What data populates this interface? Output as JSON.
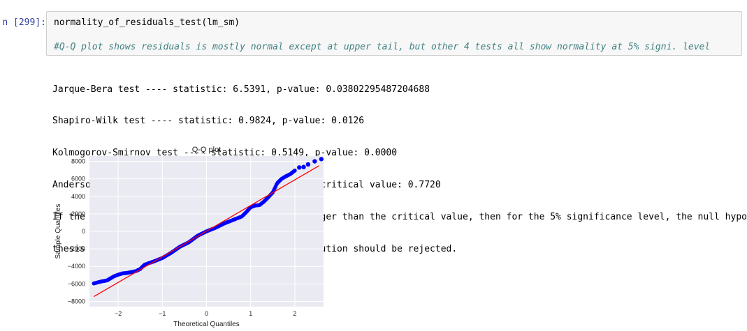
{
  "cell": {
    "prompt": "n [299]:",
    "code": "normality_of_residuals_test(lm_sm)",
    "comment": "#Q-Q plot shows residuals is mostly normal except at upper tail, but other 4 tests all show normality at 5% signi. level"
  },
  "output": {
    "lines": [
      "Jarque-Bera test ---- statistic: 6.5391, p-value: 0.03802295487204688",
      "Shapiro-Wilk test ---- statistic: 0.9824, p-value: 0.0126",
      "Kolmogorov-Smirnov test ---- statistic: 0.5149, p-value: 0.0000",
      "Anderson-Darling test ---- statistic: 0.6878, 5% critical value: 0.7720",
      "If the returned Anderson Draling statistic is larger than the critical value, then for the 5% significance level, the null hypo",
      "thesis that the data come from the Normal distribution should be rejected."
    ]
  },
  "chart_data": {
    "type": "scatter",
    "title": "Q-Q plot",
    "xlabel": "Theoretical Quantiles",
    "ylabel": "Sample Quantiles",
    "xlim": [
      -2.65,
      2.65
    ],
    "ylim": [
      -8600,
      8600
    ],
    "xticks": [
      -2,
      -1,
      0,
      1,
      2
    ],
    "xtick_labels": [
      "−2",
      "−1",
      "0",
      "1",
      "2"
    ],
    "yticks": [
      8000,
      6000,
      4000,
      2000,
      0,
      -2000,
      -4000,
      -6000,
      -8000
    ],
    "ytick_labels": [
      "8000",
      "6000",
      "4000",
      "2000",
      "0",
      "−2000",
      "−4000",
      "−6000",
      "−8000"
    ],
    "grid": true,
    "background": "#eaeaf2",
    "point_color": "#0000ff",
    "line_color": "#ff0000",
    "reference_line": {
      "x": [
        -2.55,
        2.55
      ],
      "y": [
        -7450,
        7500
      ]
    },
    "anchors": {
      "x": [
        -2.55,
        -2.4,
        -2.25,
        -2.1,
        -2.0,
        -1.9,
        -1.8,
        -1.6,
        -1.5,
        -1.4,
        -1.2,
        -1.0,
        -0.8,
        -0.6,
        -0.4,
        -0.2,
        0.0,
        0.2,
        0.4,
        0.6,
        0.8,
        0.9,
        1.0,
        1.1,
        1.2,
        1.3,
        1.4,
        1.5,
        1.6,
        1.7,
        1.8,
        1.9,
        2.0
      ],
      "y": [
        -5950,
        -5750,
        -5600,
        -5150,
        -4950,
        -4800,
        -4750,
        -4550,
        -4300,
        -3800,
        -3450,
        -3050,
        -2450,
        -1750,
        -1250,
        -500,
        0,
        400,
        900,
        1300,
        1700,
        2200,
        2750,
        2950,
        3000,
        3400,
        3900,
        4450,
        5500,
        6000,
        6300,
        6550,
        6950
      ]
    },
    "tail_points": [
      {
        "x": 2.1,
        "y": 7300
      },
      {
        "x": 2.2,
        "y": 7350
      },
      {
        "x": 2.3,
        "y": 7650
      },
      {
        "x": 2.45,
        "y": 8000
      },
      {
        "x": 2.6,
        "y": 8250
      }
    ],
    "n_points": 200
  }
}
